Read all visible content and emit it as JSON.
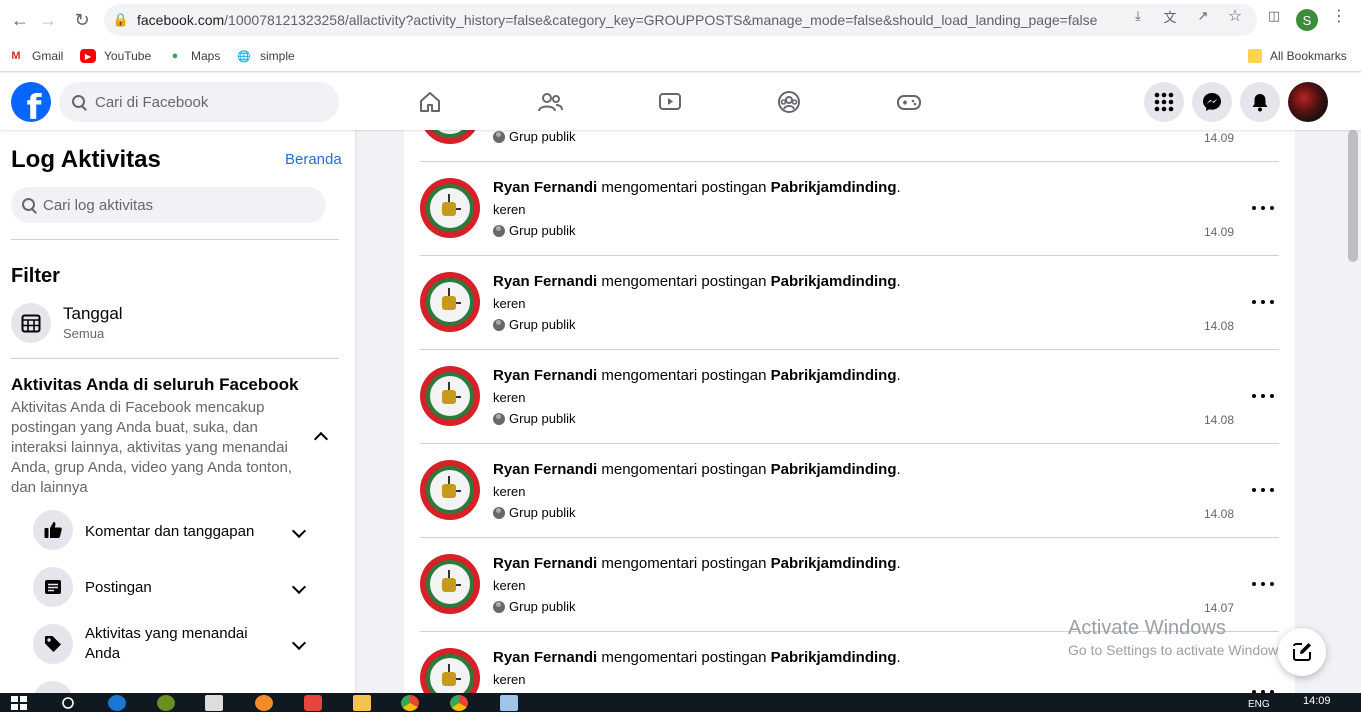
{
  "browser": {
    "url_host": "facebook.com",
    "url_path": "/100078121323258/allactivity?activity_history=false&category_key=GROUPPOSTS&manage_mode=false&should_load_landing_page=false",
    "profile_initial": "S",
    "bookmarks": [
      {
        "label": "Gmail",
        "icon": "gmail-icon"
      },
      {
        "label": "YouTube",
        "icon": "youtube-icon"
      },
      {
        "label": "Maps",
        "icon": "maps-icon"
      },
      {
        "label": "simple",
        "icon": "globe-icon"
      }
    ],
    "all_bookmarks": "All Bookmarks"
  },
  "fb": {
    "logo": "f",
    "search_placeholder": "Cari di Facebook",
    "nav_icons": [
      "home-icon",
      "friends-icon",
      "watch-icon",
      "groups-icon",
      "gaming-icon"
    ]
  },
  "sidebar": {
    "title": "Log Aktivitas",
    "home_link": "Beranda",
    "search_placeholder": "Cari log aktivitas",
    "filter_title": "Filter",
    "date_filter": {
      "label": "Tanggal",
      "value": "Semua"
    },
    "section_title": "Aktivitas Anda di seluruh Facebook",
    "section_desc": "Aktivitas Anda di Facebook mencakup postingan yang Anda buat, suka, dan interaksi lainnya, aktivitas yang menandai Anda, grup Anda, video yang Anda tonton, dan lainnya",
    "categories": [
      {
        "label": "Komentar dan tanggapan",
        "icon": "thumbs-up-icon"
      },
      {
        "label": "Postingan",
        "icon": "post-icon"
      },
      {
        "label": "Aktivitas yang menandai Anda",
        "icon": "tag-icon"
      }
    ]
  },
  "feed": {
    "partial_top": {
      "audience": "Grup publik",
      "time": "14.09"
    },
    "items": [
      {
        "actor": "Ryan Fernandi",
        "verb": " mengomentari postingan ",
        "target": "Pabrikjamdinding",
        "end": ".",
        "comment": "keren",
        "audience": "Grup publik",
        "time": "14.09"
      },
      {
        "actor": "Ryan Fernandi",
        "verb": " mengomentari postingan ",
        "target": "Pabrikjamdinding",
        "end": ".",
        "comment": "keren",
        "audience": "Grup publik",
        "time": "14.08"
      },
      {
        "actor": "Ryan Fernandi",
        "verb": " mengomentari postingan ",
        "target": "Pabrikjamdinding",
        "end": ".",
        "comment": "keren",
        "audience": "Grup publik",
        "time": "14.08"
      },
      {
        "actor": "Ryan Fernandi",
        "verb": " mengomentari postingan ",
        "target": "Pabrikjamdinding",
        "end": ".",
        "comment": "keren",
        "audience": "Grup publik",
        "time": "14.08"
      },
      {
        "actor": "Ryan Fernandi",
        "verb": " mengomentari postingan ",
        "target": "Pabrikjamdinding",
        "end": ".",
        "comment": "keren",
        "audience": "Grup publik",
        "time": "14.07"
      },
      {
        "actor": "Ryan Fernandi",
        "verb": " mengomentari postingan ",
        "target": "Pabrikjamdinding",
        "end": ".",
        "comment": "keren",
        "audience": "",
        "time": ""
      }
    ]
  },
  "watermark": {
    "line1": "Activate Windows",
    "line2": "Go to Settings to activate Windows."
  },
  "taskbar": {
    "time": "14:09",
    "lang": "ENG"
  },
  "colors": {
    "fb_blue": "#0866ff",
    "link": "#216fdb"
  }
}
